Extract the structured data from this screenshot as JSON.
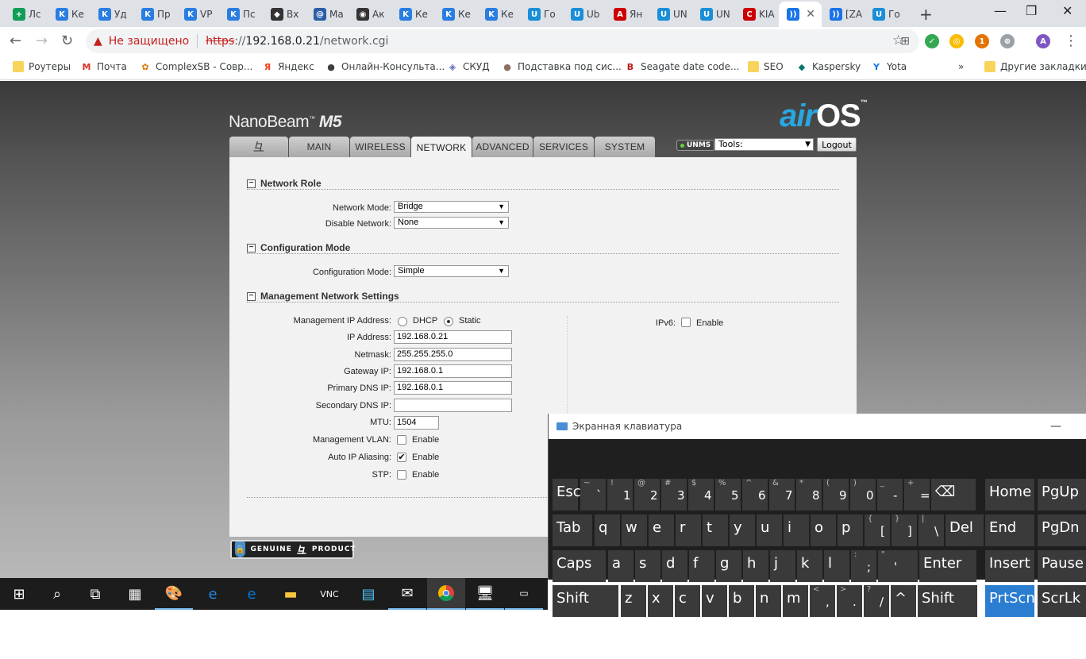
{
  "browser": {
    "tabs": [
      {
        "label": "Лс",
        "color": "#0f9d58",
        "glyph": "+"
      },
      {
        "label": "Ке",
        "color": "#2a7de1",
        "glyph": "K"
      },
      {
        "label": "Уд",
        "color": "#2a7de1",
        "glyph": "K"
      },
      {
        "label": "Пр",
        "color": "#2a7de1",
        "glyph": "K"
      },
      {
        "label": "VP",
        "color": "#2a7de1",
        "glyph": "K"
      },
      {
        "label": "Пс",
        "color": "#2a7de1",
        "glyph": "K"
      },
      {
        "label": "Вх",
        "color": "#333333",
        "glyph": "◆"
      },
      {
        "label": "Ма",
        "color": "#2b5ea7",
        "glyph": "@"
      },
      {
        "label": "Ак",
        "color": "#333333",
        "glyph": "◉"
      },
      {
        "label": "Ке",
        "color": "#2a7de1",
        "glyph": "K"
      },
      {
        "label": "Ке",
        "color": "#2a7de1",
        "glyph": "K"
      },
      {
        "label": "Ке",
        "color": "#2a7de1",
        "glyph": "K"
      },
      {
        "label": "Го",
        "color": "#1a8fd8",
        "glyph": "U"
      },
      {
        "label": "Ub",
        "color": "#1a8fd8",
        "glyph": "U"
      },
      {
        "label": "Ян",
        "color": "#cc0000",
        "glyph": "A"
      },
      {
        "label": "UN",
        "color": "#1a8fd8",
        "glyph": "U"
      },
      {
        "label": "UN",
        "color": "#1a8fd8",
        "glyph": "U"
      },
      {
        "label": "KIA",
        "color": "#cc0000",
        "glyph": "C"
      },
      {
        "label": "",
        "color": "#1a73e8",
        "glyph": "))",
        "active": true
      },
      {
        "label": "[ZA",
        "color": "#1a73e8",
        "glyph": "))"
      },
      {
        "label": "Го",
        "color": "#1a8fd8",
        "glyph": "U"
      }
    ],
    "url": {
      "warning": "Не защищено",
      "scheme": "https",
      "rest": "://",
      "host": "192.168.0.21",
      "path": "/network.cgi"
    },
    "bookmarks": [
      {
        "label": "Роутеры",
        "type": "folder"
      },
      {
        "label": "Почта",
        "icon": "M",
        "color": "#d93025"
      },
      {
        "label": "ComplexSB - Совр...",
        "icon": "✿",
        "color": "#e37400"
      },
      {
        "label": "Яндекс",
        "icon": "Я",
        "color": "#fc3f1d"
      },
      {
        "label": "Онлайн-Консульта...",
        "icon": "●",
        "color": "#3c4043"
      },
      {
        "label": "СКУД",
        "icon": "◈",
        "color": "#5b6bc0"
      },
      {
        "label": "Подставка под сис...",
        "icon": "●",
        "color": "#8d6e63"
      },
      {
        "label": "Seagate date code...",
        "icon": "B",
        "color": "#b71c1c"
      },
      {
        "label": "SEO",
        "type": "folder"
      },
      {
        "label": "Kaspersky",
        "icon": "◆",
        "color": "#00796b"
      },
      {
        "label": "Yota",
        "icon": "Y",
        "color": "#1a73e8"
      }
    ],
    "bookmarks_more": "»",
    "other_bookmarks": "Другие закладки",
    "avatar": "A"
  },
  "airos": {
    "product": "NanoBeam",
    "model": "M5",
    "tm": "™",
    "logo_air": "air",
    "logo_os": "OS",
    "nav_tabs": [
      "MAIN",
      "WIRELESS",
      "NETWORK",
      "ADVANCED",
      "SERVICES",
      "SYSTEM"
    ],
    "active_tab": "NETWORK",
    "unms": "UNMS",
    "tools_label": "Tools:",
    "logout": "Logout",
    "sections": {
      "network_role": {
        "title": "Network Role",
        "network_mode_label": "Network Mode:",
        "network_mode": "Bridge",
        "disable_network_label": "Disable Network:",
        "disable_network": "None"
      },
      "config_mode": {
        "title": "Configuration Mode",
        "label": "Configuration Mode:",
        "value": "Simple"
      },
      "mgmt": {
        "title": "Management Network Settings",
        "mgmt_ip_label": "Management IP Address:",
        "dhcp": "DHCP",
        "static": "Static",
        "selected": "Static",
        "ip_label": "IP Address:",
        "ip": "192.168.0.21",
        "netmask_label": "Netmask:",
        "netmask": "255.255.255.0",
        "gateway_label": "Gateway IP:",
        "gateway": "192.168.0.1",
        "dns1_label": "Primary DNS IP:",
        "dns1": "192.168.0.1",
        "dns2_label": "Secondary DNS IP:",
        "dns2": "",
        "mtu_label": "MTU:",
        "mtu": "1504",
        "vlan_label": "Management VLAN:",
        "vlan_checked": false,
        "alias_label": "Auto IP Aliasing:",
        "alias_checked": true,
        "stp_label": "STP:",
        "stp_checked": false,
        "enable": "Enable",
        "ipv6_label": "IPv6:",
        "ipv6_checked": false
      }
    },
    "genuine": "GENUINE",
    "product_word": "PRODUCT"
  },
  "osk": {
    "title": "Экранная клавиатура",
    "minimize": "—",
    "rows": [
      [
        {
          "m": "Esc"
        },
        {
          "s": "~",
          "b": "`"
        },
        {
          "s": "!",
          "b": "1"
        },
        {
          "s": "@",
          "b": "2"
        },
        {
          "s": "#",
          "b": "3"
        },
        {
          "s": "$",
          "b": "4"
        },
        {
          "s": "%",
          "b": "5"
        },
        {
          "s": "^",
          "b": "6"
        },
        {
          "s": "&",
          "b": "7"
        },
        {
          "s": "*",
          "b": "8"
        },
        {
          "s": "(",
          "b": "9"
        },
        {
          "s": ")",
          "b": "0"
        },
        {
          "s": "_",
          "b": "-"
        },
        {
          "s": "+",
          "b": "="
        },
        {
          "m": "⌫"
        },
        {
          "m": "Home"
        },
        {
          "m": "PgUp"
        }
      ],
      [
        {
          "m": "Tab"
        },
        {
          "m": "q"
        },
        {
          "m": "w"
        },
        {
          "m": "e"
        },
        {
          "m": "r"
        },
        {
          "m": "t"
        },
        {
          "m": "y"
        },
        {
          "m": "u"
        },
        {
          "m": "i"
        },
        {
          "m": "o"
        },
        {
          "m": "p"
        },
        {
          "s": "{",
          "b": "["
        },
        {
          "s": "}",
          "b": "]"
        },
        {
          "s": "|",
          "b": "\\"
        },
        {
          "m": "Del"
        },
        {
          "m": "End"
        },
        {
          "m": "PgDn"
        }
      ],
      [
        {
          "m": "Caps"
        },
        {
          "m": "a"
        },
        {
          "m": "s"
        },
        {
          "m": "d"
        },
        {
          "m": "f"
        },
        {
          "m": "g"
        },
        {
          "m": "h"
        },
        {
          "m": "j"
        },
        {
          "m": "k"
        },
        {
          "m": "l"
        },
        {
          "s": ":",
          "b": ";"
        },
        {
          "s": "\"",
          "b": "'"
        },
        {
          "m": "Enter"
        },
        {
          "m": "Insert"
        },
        {
          "m": "Pause"
        }
      ],
      [
        {
          "m": "Shift"
        },
        {
          "m": "z"
        },
        {
          "m": "x"
        },
        {
          "m": "c"
        },
        {
          "m": "v"
        },
        {
          "m": "b"
        },
        {
          "m": "n"
        },
        {
          "m": "m"
        },
        {
          "s": "<",
          "b": ","
        },
        {
          "s": ">",
          "b": "."
        },
        {
          "s": "?",
          "b": "/"
        },
        {
          "m": "^"
        },
        {
          "m": "Shift"
        },
        {
          "m": "PrtScn",
          "hl": true
        },
        {
          "m": "ScrLk"
        }
      ]
    ]
  },
  "taskbar": {
    "items": [
      "windows-start",
      "search",
      "task-view",
      "calculator",
      "paint",
      "internet-explorer",
      "edge",
      "file-explorer",
      "vnc",
      "network-app",
      "mail",
      "chrome",
      "remote-desktop",
      "terminal"
    ]
  }
}
